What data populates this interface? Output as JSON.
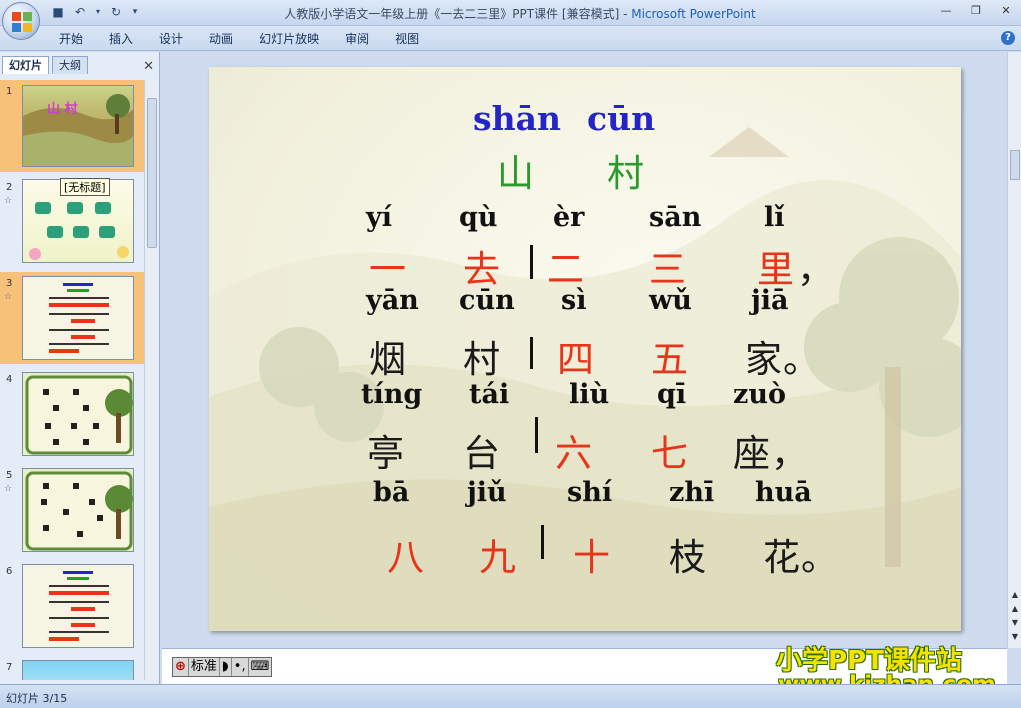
{
  "window": {
    "title": "人教版小学语文一年级上册《一去二三里》PPT课件 [兼容模式] - ",
    "app_name": "Microsoft PowerPoint"
  },
  "ribbon": {
    "tabs": [
      "开始",
      "插入",
      "设计",
      "动画",
      "幻灯片放映",
      "审阅",
      "视图"
    ]
  },
  "left_pane": {
    "tab_slides": "幻灯片",
    "tab_outline": "大纲",
    "tooltip": "[无标题]",
    "thumbnails": [
      {
        "num": "1",
        "title": "山 村"
      },
      {
        "num": "2"
      },
      {
        "num": "3"
      },
      {
        "num": "4"
      },
      {
        "num": "5"
      },
      {
        "num": "6"
      },
      {
        "num": "7"
      }
    ]
  },
  "slide": {
    "title_pinyin": [
      "shān",
      "cūn"
    ],
    "title_hanzi": [
      "山",
      "村"
    ],
    "lines": [
      {
        "pinyin": [
          "yí",
          "qù",
          "èr",
          "sān",
          "lǐ"
        ],
        "hanzi": [
          "一",
          "去",
          "二",
          "三",
          "里"
        ],
        "punct": "，"
      },
      {
        "pinyin": [
          "yān",
          "cūn",
          "sì",
          "wǔ",
          "jiā"
        ],
        "hanzi": [
          "烟",
          "村",
          "四",
          "五",
          "家"
        ],
        "punct": "。"
      },
      {
        "pinyin": [
          "tíng",
          "tái",
          "liù",
          "qī",
          "zuò"
        ],
        "hanzi": [
          "亭",
          "台",
          "六",
          "七",
          "座"
        ],
        "punct": "，"
      },
      {
        "pinyin": [
          "bā",
          "jiǔ",
          "shí",
          "zhī",
          "huā"
        ],
        "hanzi": [
          "八",
          "九",
          "十",
          "枝",
          "花"
        ],
        "punct": "。"
      }
    ]
  },
  "ime": {
    "mode": "标准"
  },
  "watermark": {
    "line1": "小学PPT课件站",
    "line2": "www.kjzhan.com"
  },
  "status": {
    "slide_counter": "幻灯片 3/15"
  }
}
